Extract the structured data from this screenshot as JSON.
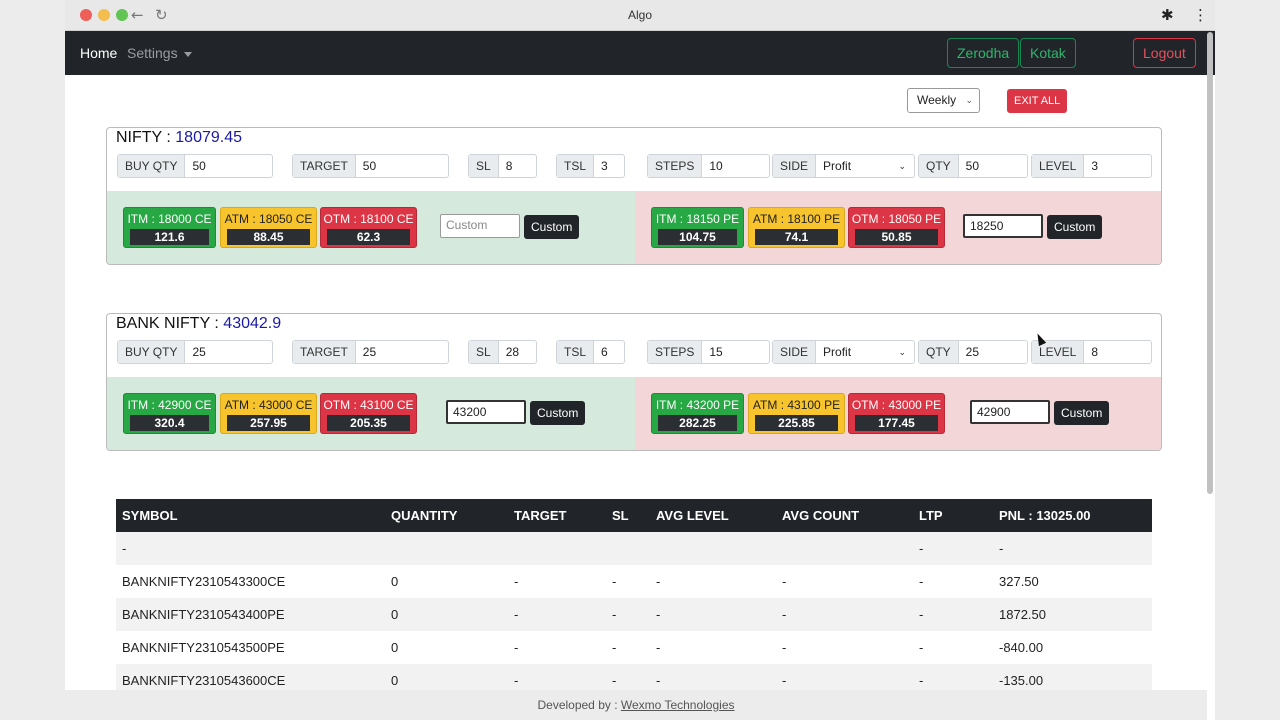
{
  "window": {
    "title": "Algo"
  },
  "nav": {
    "home": "Home",
    "settings": "Settings",
    "zerodha": "Zerodha",
    "kotak": "Kotak",
    "logout": "Logout"
  },
  "controls": {
    "expiry": "Weekly",
    "exit_all": "EXIT ALL"
  },
  "panels": [
    {
      "name": "NIFTY",
      "sep": " : ",
      "price": "18079.45",
      "fields": {
        "buy_qty": {
          "label": "BUY QTY",
          "value": "50"
        },
        "target": {
          "label": "TARGET",
          "value": "50"
        },
        "sl": {
          "label": "SL",
          "value": "8"
        },
        "tsl": {
          "label": "TSL",
          "value": "3"
        },
        "steps": {
          "label": "STEPS",
          "value": "10"
        },
        "side": {
          "label": "SIDE",
          "value": "Profit"
        },
        "qty": {
          "label": "QTY",
          "value": "50"
        },
        "level": {
          "label": "LEVEL",
          "value": "3"
        }
      },
      "ce": [
        {
          "label": "ITM : 18000 CE",
          "value": "121.6"
        },
        {
          "label": "ATM : 18050 CE",
          "value": "88.45"
        },
        {
          "label": "OTM : 18100 CE",
          "value": "62.3"
        }
      ],
      "pe": [
        {
          "label": "ITM : 18150 PE",
          "value": "104.75"
        },
        {
          "label": "ATM : 18100 PE",
          "value": "74.1"
        },
        {
          "label": "OTM : 18050 PE",
          "value": "50.85"
        }
      ],
      "ce_custom": {
        "value": "",
        "placeholder": "Custom",
        "button": "Custom"
      },
      "pe_custom": {
        "value": "18250",
        "placeholder": "Custom",
        "button": "Custom"
      }
    },
    {
      "name": "BANK NIFTY",
      "sep": " : ",
      "price": "43042.9",
      "fields": {
        "buy_qty": {
          "label": "BUY QTY",
          "value": "25"
        },
        "target": {
          "label": "TARGET",
          "value": "25"
        },
        "sl": {
          "label": "SL",
          "value": "28"
        },
        "tsl": {
          "label": "TSL",
          "value": "6"
        },
        "steps": {
          "label": "STEPS",
          "value": "15"
        },
        "side": {
          "label": "SIDE",
          "value": "Profit"
        },
        "qty": {
          "label": "QTY",
          "value": "25"
        },
        "level": {
          "label": "LEVEL",
          "value": "8"
        }
      },
      "ce": [
        {
          "label": "ITM : 42900 CE",
          "value": "320.4"
        },
        {
          "label": "ATM : 43000 CE",
          "value": "257.95"
        },
        {
          "label": "OTM : 43100 CE",
          "value": "205.35"
        }
      ],
      "pe": [
        {
          "label": "ITM : 43200 PE",
          "value": "282.25"
        },
        {
          "label": "ATM : 43100 PE",
          "value": "225.85"
        },
        {
          "label": "OTM : 43000 PE",
          "value": "177.45"
        }
      ],
      "ce_custom": {
        "value": "43200",
        "placeholder": "Custom",
        "button": "Custom"
      },
      "pe_custom": {
        "value": "42900",
        "placeholder": "Custom",
        "button": "Custom"
      }
    }
  ],
  "table": {
    "headers": [
      "SYMBOL",
      "QUANTITY",
      "TARGET",
      "SL",
      "AVG LEVEL",
      "AVG COUNT",
      "LTP",
      "PNL : 13025.00"
    ],
    "rows": [
      [
        "-",
        "",
        "",
        "",
        "",
        "",
        "-",
        "-"
      ],
      [
        "BANKNIFTY2310543300CE",
        "0",
        "-",
        "-",
        "-",
        "-",
        "-",
        "327.50"
      ],
      [
        "BANKNIFTY2310543400PE",
        "0",
        "-",
        "-",
        "-",
        "-",
        "-",
        "1872.50"
      ],
      [
        "BANKNIFTY2310543500PE",
        "0",
        "-",
        "-",
        "-",
        "-",
        "-",
        "-840.00"
      ],
      [
        "BANKNIFTY2310543600CE",
        "0",
        "-",
        "-",
        "-",
        "-",
        "-",
        "-135.00"
      ]
    ]
  },
  "footer": {
    "prefix": "Developed by : ",
    "link": "Wexmo Technologies"
  },
  "colors": {
    "ce_bg": "#d5eadd",
    "pe_bg": "#f2d6d8",
    "itm": "#28a745",
    "atm": "#f8c42d",
    "otm": "#dc3545",
    "price": "#1a1aa6"
  }
}
